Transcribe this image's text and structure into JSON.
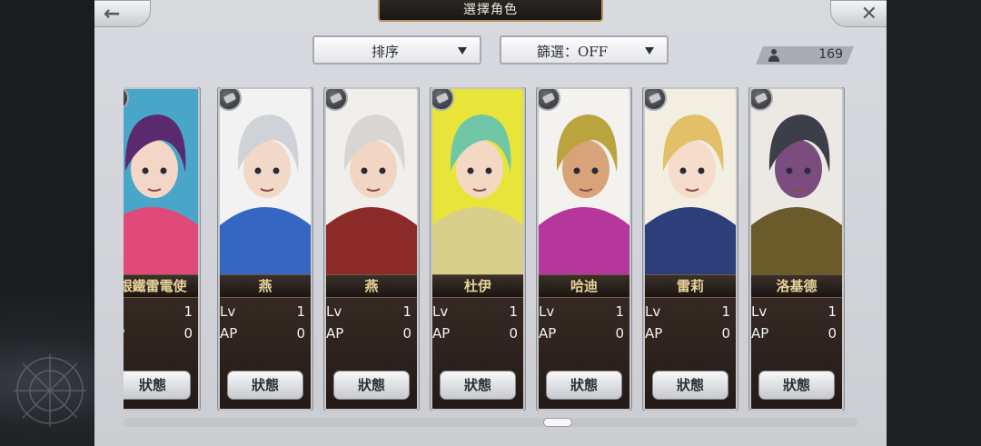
{
  "header": {
    "title": "選擇角色",
    "back_icon": "←",
    "close_icon": "✕"
  },
  "toolbar": {
    "sort_label": "排序",
    "filter_label": "篩選：OFF",
    "character_count": "169"
  },
  "stat_labels": {
    "level": "Lv",
    "ap": "AP"
  },
  "characters": [
    {
      "name": "銀鐵雷電使",
      "level": "1",
      "ap": "0",
      "status_label": "狀態",
      "palette": {
        "bg": "#4aa6c8",
        "hair": "#5b2a6e",
        "accent": "#e04a7a",
        "skin": "#f4d6c6"
      }
    },
    {
      "name": "燕",
      "level": "1",
      "ap": "0",
      "status_label": "狀態",
      "palette": {
        "bg": "#f2f2f2",
        "hair": "#cfd2d6",
        "accent": "#3466c2",
        "skin": "#f2d8c6"
      }
    },
    {
      "name": "燕",
      "level": "1",
      "ap": "0",
      "status_label": "狀態",
      "palette": {
        "bg": "#f1efec",
        "hair": "#d8d6d3",
        "accent": "#8c2a2a",
        "skin": "#f1d6c4"
      }
    },
    {
      "name": "杜伊",
      "level": "1",
      "ap": "0",
      "status_label": "狀態",
      "palette": {
        "bg": "#e8e43a",
        "hair": "#6fc7a8",
        "accent": "#d8cf8a",
        "skin": "#f3d8c3"
      }
    },
    {
      "name": "哈迪",
      "level": "1",
      "ap": "0",
      "status_label": "狀態",
      "palette": {
        "bg": "#f4f2ee",
        "hair": "#b9a43e",
        "accent": "#b6379c",
        "skin": "#d9a37a"
      }
    },
    {
      "name": "雷莉",
      "level": "1",
      "ap": "0",
      "status_label": "狀態",
      "palette": {
        "bg": "#f3eee2",
        "hair": "#e3c067",
        "accent": "#2c3f7a",
        "skin": "#f5dccb"
      }
    },
    {
      "name": "洛基德",
      "level": "1",
      "ap": "0",
      "status_label": "狀態",
      "palette": {
        "bg": "#ece9e4",
        "hair": "#3c3f4a",
        "accent": "#6b5a2a",
        "skin": "#7a4d7e"
      }
    }
  ]
}
